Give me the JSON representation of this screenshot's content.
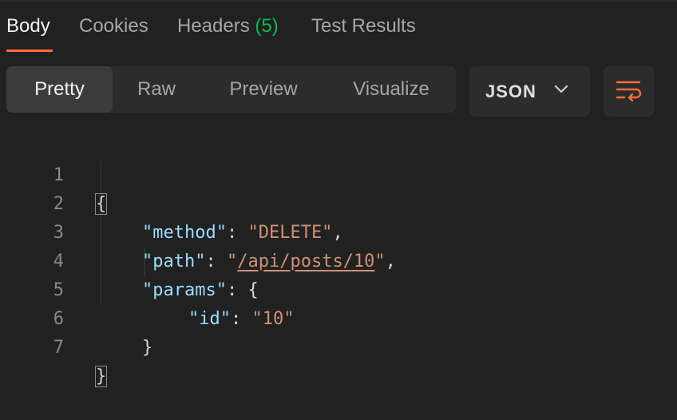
{
  "tabs": [
    {
      "label": "Body",
      "active": true
    },
    {
      "label": "Cookies",
      "active": false
    },
    {
      "label": "Headers",
      "count": "(5)",
      "active": false
    },
    {
      "label": "Test Results",
      "active": false
    }
  ],
  "view_modes": [
    {
      "label": "Pretty",
      "active": true
    },
    {
      "label": "Raw",
      "active": false
    },
    {
      "label": "Preview",
      "active": false
    },
    {
      "label": "Visualize",
      "active": false
    }
  ],
  "format_select": {
    "value": "JSON"
  },
  "icons": {
    "format_select": "chevron-down-icon",
    "wrap_button": "wrap-lines-icon"
  },
  "colors": {
    "accent": "#ff6c37",
    "count": "#0cbb52",
    "json_key": "#9cdcfe",
    "json_string": "#ce9178"
  },
  "code": {
    "line_numbers": [
      "1",
      "2",
      "3",
      "4",
      "5",
      "6",
      "7"
    ],
    "open_brace": "{",
    "close_brace": "}",
    "method_key": "\"method\"",
    "method_value": "\"DELETE\"",
    "path_key": "\"path\"",
    "path_value": "/api/posts/10",
    "params_key": "\"params\"",
    "id_key": "\"id\"",
    "id_value": "\"10\""
  }
}
